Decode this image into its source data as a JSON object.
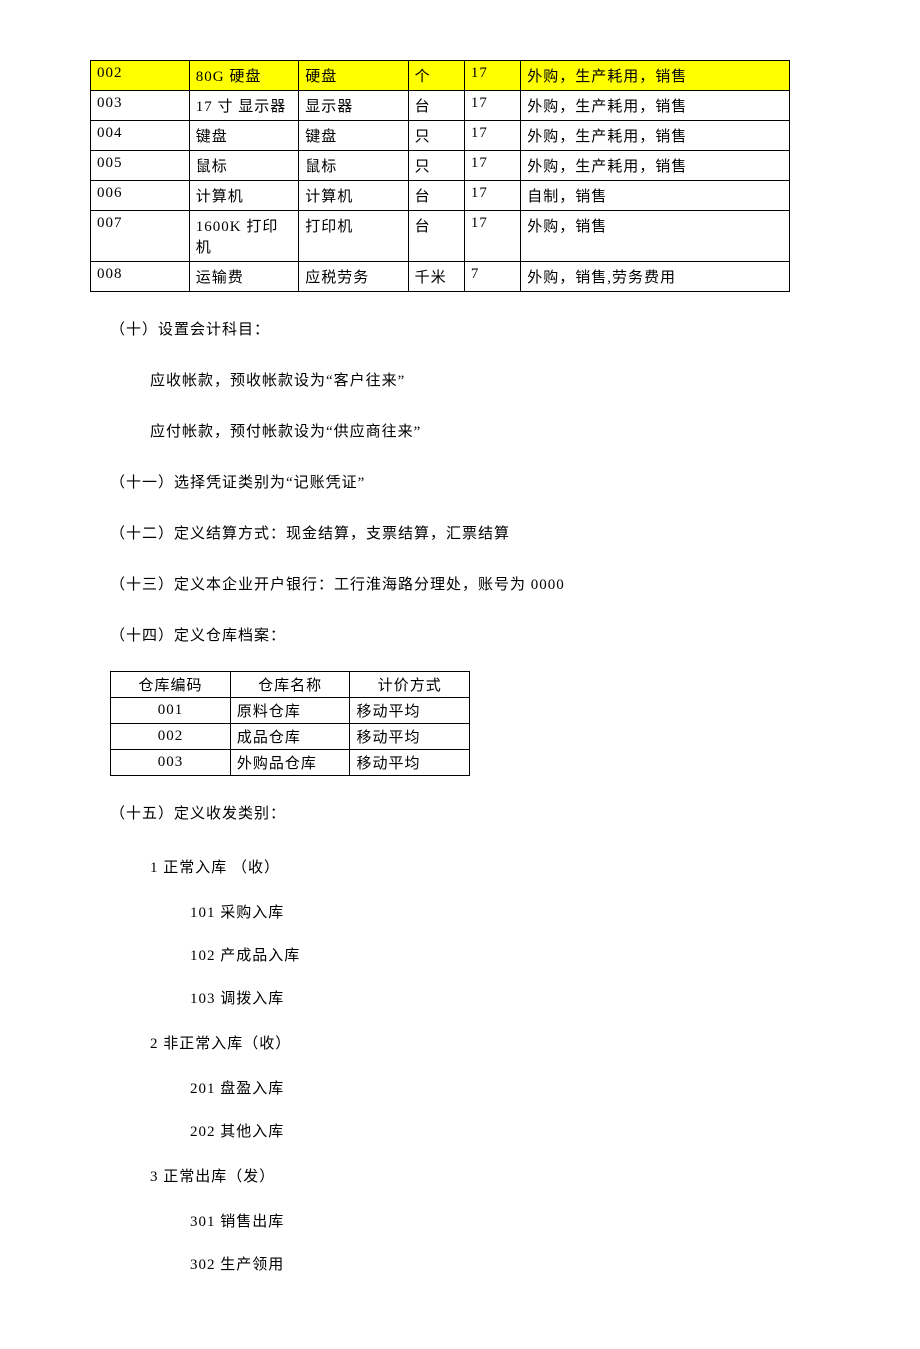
{
  "table1": {
    "rows": [
      {
        "code": "002",
        "name": "80G 硬盘",
        "cat": "硬盘",
        "unit": "个",
        "rate": "17",
        "attr": "外购，生产耗用，销售",
        "hl": true
      },
      {
        "code": "003",
        "name": "17 寸 显示器",
        "cat": "显示器",
        "unit": "台",
        "rate": "17",
        "attr": "外购，生产耗用，销售",
        "hl": false
      },
      {
        "code": "004",
        "name": "键盘",
        "cat": "键盘",
        "unit": "只",
        "rate": "17",
        "attr": "外购，生产耗用，销售",
        "hl": false
      },
      {
        "code": "005",
        "name": "鼠标",
        "cat": "鼠标",
        "unit": "只",
        "rate": "17",
        "attr": "外购，生产耗用，销售",
        "hl": false
      },
      {
        "code": "006",
        "name": "计算机",
        "cat": "计算机",
        "unit": "台",
        "rate": "17",
        "attr": "自制，销售",
        "hl": false
      },
      {
        "code": "007",
        "name": "1600K 打印机",
        "cat": "打印机",
        "unit": "台",
        "rate": "17",
        "attr": "外购，销售",
        "hl": false
      },
      {
        "code": "008",
        "name": "运输费",
        "cat": "应税劳务",
        "unit": "千米",
        "rate": "7",
        "attr": "外购，销售,劳务费用",
        "hl": false
      }
    ]
  },
  "p10_title": "（十）设置会计科目：",
  "p10_a": "应收帐款，预收帐款设为“客户往来”",
  "p10_b": "应付帐款，预付帐款设为“供应商往来”",
  "p11": "（十一）选择凭证类别为“记账凭证”",
  "p12": "（十二）定义结算方式：现金结算，支票结算，汇票结算",
  "p13": "（十三）定义本企业开户银行：工行淮海路分理处，账号为 0000",
  "p14": "（十四）定义仓库档案：",
  "table2": {
    "headers": [
      "仓库编码",
      "仓库名称",
      "计价方式"
    ],
    "rows": [
      {
        "code": "001",
        "name": "原料仓库",
        "method": "移动平均"
      },
      {
        "code": "002",
        "name": "成品仓库",
        "method": "移动平均"
      },
      {
        "code": "003",
        "name": "外购品仓库",
        "method": "移动平均"
      }
    ]
  },
  "p15": "（十五）定义收发类别：",
  "cats": [
    {
      "title": "1 正常入库 （收）",
      "items": [
        "101 采购入库",
        "102 产成品入库",
        "103 调拨入库"
      ]
    },
    {
      "title": "2 非正常入库（收）",
      "items": [
        "201 盘盈入库",
        "202 其他入库"
      ]
    },
    {
      "title": "3 正常出库（发）",
      "items": [
        "301 销售出库",
        "302 生产领用"
      ]
    }
  ]
}
